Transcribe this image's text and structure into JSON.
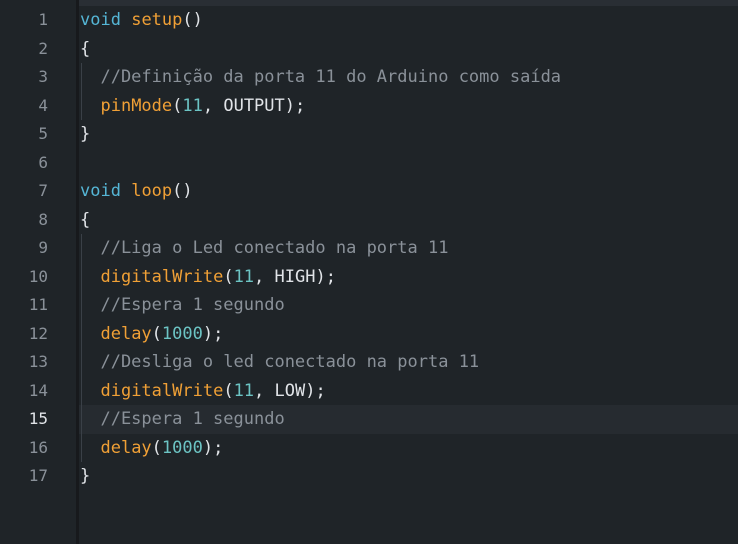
{
  "editor": {
    "lines": [
      {
        "num": "1",
        "tokens": [
          {
            "t": "void",
            "c": "kw"
          },
          {
            "t": " ",
            "c": "pn"
          },
          {
            "t": "setup",
            "c": "fn"
          },
          {
            "t": "()",
            "c": "pn"
          }
        ]
      },
      {
        "num": "2",
        "tokens": [
          {
            "t": "{",
            "c": "pn"
          }
        ]
      },
      {
        "num": "3",
        "tokens": [
          {
            "t": "  //Definição da porta 11 do Arduino como saída",
            "c": "cm"
          }
        ]
      },
      {
        "num": "4",
        "tokens": [
          {
            "t": "  ",
            "c": "pn"
          },
          {
            "t": "pinMode",
            "c": "fn"
          },
          {
            "t": "(",
            "c": "pn"
          },
          {
            "t": "11",
            "c": "num"
          },
          {
            "t": ", OUTPUT);",
            "c": "pn"
          }
        ]
      },
      {
        "num": "5",
        "tokens": [
          {
            "t": "}",
            "c": "pn"
          }
        ]
      },
      {
        "num": "6",
        "tokens": []
      },
      {
        "num": "7",
        "tokens": [
          {
            "t": "void",
            "c": "kw"
          },
          {
            "t": " ",
            "c": "pn"
          },
          {
            "t": "loop",
            "c": "fn"
          },
          {
            "t": "()",
            "c": "pn"
          }
        ]
      },
      {
        "num": "8",
        "tokens": [
          {
            "t": "{",
            "c": "pn"
          }
        ]
      },
      {
        "num": "9",
        "tokens": [
          {
            "t": "  //Liga o Led conectado na porta 11",
            "c": "cm"
          }
        ]
      },
      {
        "num": "10",
        "tokens": [
          {
            "t": "  ",
            "c": "pn"
          },
          {
            "t": "digitalWrite",
            "c": "fn"
          },
          {
            "t": "(",
            "c": "pn"
          },
          {
            "t": "11",
            "c": "num"
          },
          {
            "t": ", HIGH);",
            "c": "pn"
          }
        ]
      },
      {
        "num": "11",
        "tokens": [
          {
            "t": "  //Espera 1 segundo",
            "c": "cm"
          }
        ]
      },
      {
        "num": "12",
        "tokens": [
          {
            "t": "  ",
            "c": "pn"
          },
          {
            "t": "delay",
            "c": "fn"
          },
          {
            "t": "(",
            "c": "pn"
          },
          {
            "t": "1000",
            "c": "num"
          },
          {
            "t": ");",
            "c": "pn"
          }
        ]
      },
      {
        "num": "13",
        "tokens": [
          {
            "t": "  //Desliga o led conectado na porta 11",
            "c": "cm"
          }
        ]
      },
      {
        "num": "14",
        "tokens": [
          {
            "t": "  ",
            "c": "pn"
          },
          {
            "t": "digitalWrite",
            "c": "fn"
          },
          {
            "t": "(",
            "c": "pn"
          },
          {
            "t": "11",
            "c": "num"
          },
          {
            "t": ", LOW);",
            "c": "pn"
          }
        ]
      },
      {
        "num": "15",
        "tokens": [
          {
            "t": "  //Espera 1 segundo",
            "c": "cm"
          }
        ]
      },
      {
        "num": "16",
        "tokens": [
          {
            "t": "  ",
            "c": "pn"
          },
          {
            "t": "delay",
            "c": "fn"
          },
          {
            "t": "(",
            "c": "pn"
          },
          {
            "t": "1000",
            "c": "num"
          },
          {
            "t": ");",
            "c": "pn"
          }
        ]
      },
      {
        "num": "17",
        "tokens": [
          {
            "t": "}",
            "c": "pn"
          }
        ]
      }
    ],
    "active_line": "15"
  },
  "colors": {
    "background": "#1f2428",
    "keyword": "#55b6d6",
    "function": "#f0a036",
    "number": "#6cc4c4",
    "comment": "#8a9199",
    "text": "#e1e4e8"
  }
}
